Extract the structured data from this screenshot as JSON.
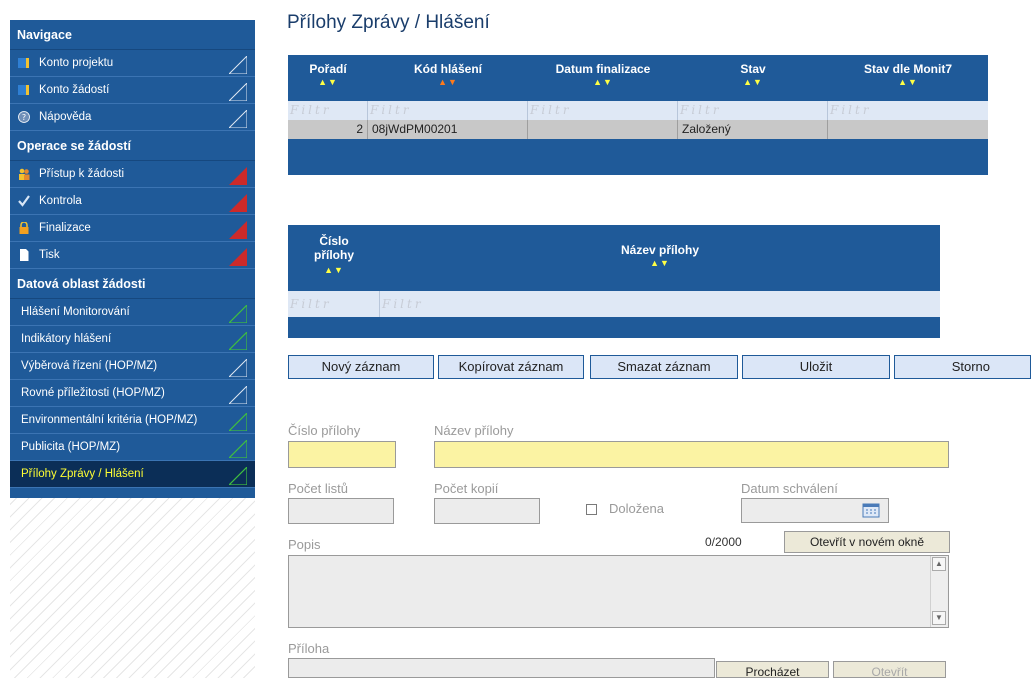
{
  "page_title": "Přílohy Zprávy / Hlášení",
  "sidebar": {
    "section1": {
      "title": "Navigace",
      "items": [
        {
          "label": "Konto projektu",
          "icon": "folder-icon"
        },
        {
          "label": "Konto žádostí",
          "icon": "folder-icon"
        },
        {
          "label": "Nápověda",
          "icon": "help-icon"
        }
      ]
    },
    "section2": {
      "title": "Operace se žádostí",
      "items": [
        {
          "label": "Přístup k žádosti",
          "icon": "users-icon"
        },
        {
          "label": "Kontrola",
          "icon": "checkmark-icon"
        },
        {
          "label": "Finalizace",
          "icon": "lock-icon"
        },
        {
          "label": "Tisk",
          "icon": "document-icon"
        }
      ]
    },
    "section3": {
      "title": "Datová oblast žádosti",
      "items": [
        {
          "label": "Hlášení Monitorování"
        },
        {
          "label": "Indikátory hlášení"
        },
        {
          "label": "Výběrová řízení (HOP/MZ)"
        },
        {
          "label": "Rovné příležitosti (HOP/MZ)"
        },
        {
          "label": "Environmentální kritéria (HOP/MZ)"
        },
        {
          "label": "Publicita (HOP/MZ)"
        },
        {
          "label": "Přílohy Zprávy / Hlášení",
          "active": true
        }
      ]
    }
  },
  "grid1": {
    "columns": [
      "Pořadí",
      "Kód hlášení",
      "Datum finalizace",
      "Stav",
      "Stav dle Monit7"
    ],
    "filter_placeholder": "Filtr",
    "rows": [
      {
        "poradi": "2",
        "kod": "08jWdPM00201",
        "datum": "",
        "stav": "Založený",
        "stav_monit": ""
      }
    ]
  },
  "grid2": {
    "columns": [
      "Číslo přílohy",
      "Název přílohy"
    ],
    "filter_placeholder": "Filtr"
  },
  "sort_arrows": "▲▼",
  "buttons": {
    "new": "Nový záznam",
    "copy": "Kopírovat záznam",
    "delete": "Smazat záznam",
    "save": "Uložit",
    "cancel": "Storno"
  },
  "form": {
    "cislo_label": "Číslo přílohy",
    "nazev_label": "Název přílohy",
    "pocet_listu_label": "Počet listů",
    "pocet_kopii_label": "Počet kopií",
    "dolozena_label": "Doložena",
    "datum_label": "Datum schválení",
    "popis_label": "Popis",
    "char_count": "0/2000",
    "open_window": "Otevřít v novém okně",
    "priloha_label": "Příloha",
    "browse": "Procházet",
    "open": "Otevřít"
  },
  "colors": {
    "nav_blue": "#1f5a99",
    "nav_active": "#0b2e57",
    "active_text": "#ffff33",
    "input_yellow": "#fbf3a3"
  }
}
